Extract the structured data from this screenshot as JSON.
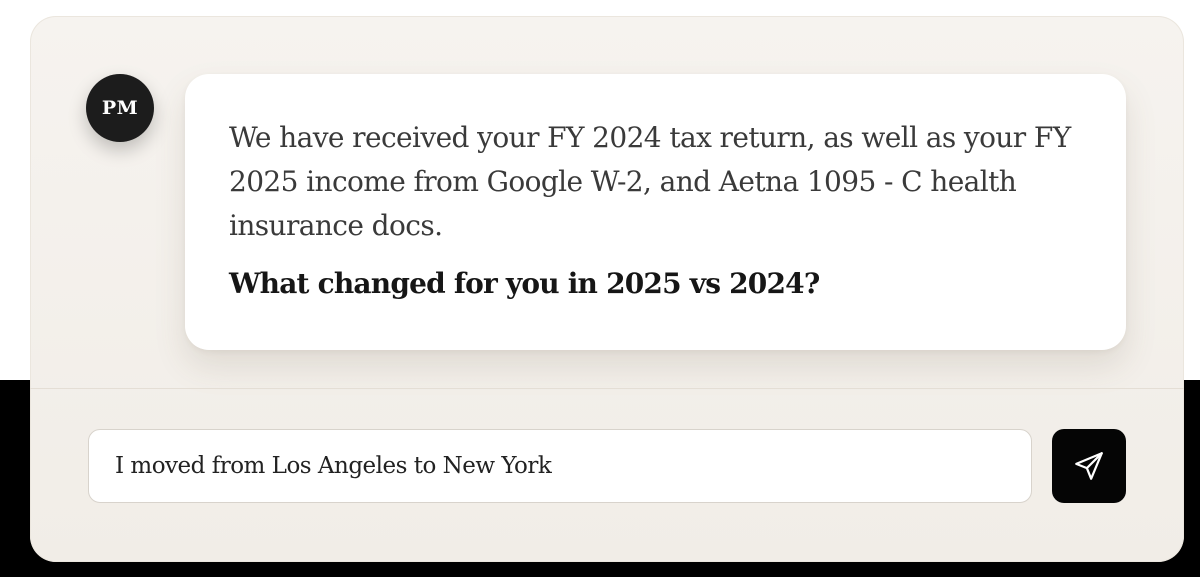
{
  "assistant": {
    "avatar_initials": "PM",
    "message": "We have received your FY 2024 tax return, as well as your FY 2025 income from Google W-2, and Aetna 1095 - C health insurance docs.",
    "question": "What changed for you in 2025 vs 2024?"
  },
  "composer": {
    "input_value": "I moved from Los Angeles to New York",
    "send_icon": "send-icon"
  },
  "colors": {
    "card_background": "#f4f1ec",
    "bubble_background": "#ffffff",
    "avatar_background": "#1c1c1c",
    "send_button_background": "#050505"
  }
}
